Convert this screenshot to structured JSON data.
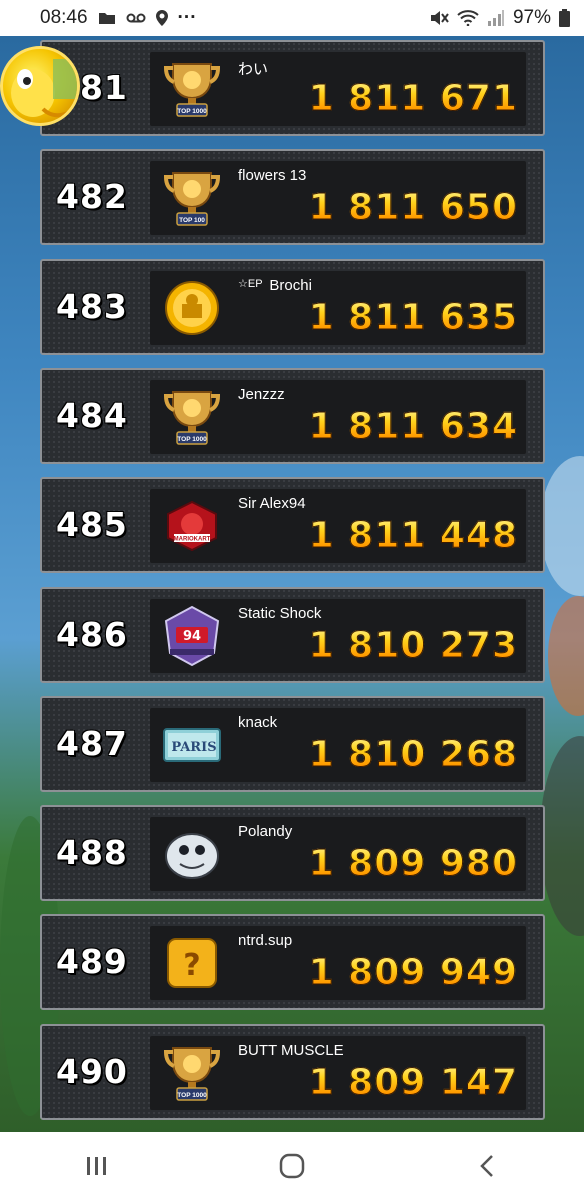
{
  "status_bar": {
    "time": "08:46",
    "battery": "97%",
    "dots": "···"
  },
  "colors": {
    "score_gradient_top": "#fff7a0",
    "score_gradient_bottom": "#ff6a00",
    "row_bg": "#2a2d31",
    "panel_bg": "#1a1b1d"
  },
  "leaderboard": [
    {
      "rank": "481",
      "name": "わい",
      "score": "1 811 671",
      "badge": "trophy-top1000-icon"
    },
    {
      "rank": "482",
      "name": "flowers 13",
      "score": "1 811 650",
      "badge": "trophy-top100-icon"
    },
    {
      "rank": "483",
      "name": "Brochi",
      "score": "1 811 635",
      "badge": "gold-medal-icon"
    },
    {
      "rank": "484",
      "name": "Jenzzz",
      "score": "1 811 634",
      "badge": "trophy-top1000-icon"
    },
    {
      "rank": "485",
      "name": "Sir Alex94",
      "score": "1 811 448",
      "badge": "mariokart-tour-emblem-icon"
    },
    {
      "rank": "486",
      "name": "Static Shock",
      "score": "1 810 273",
      "badge": "number-94-emblem-icon"
    },
    {
      "rank": "487",
      "name": "knack",
      "score": "1 810 268",
      "badge": "paris-sign-icon"
    },
    {
      "rank": "488",
      "name": "Polandy",
      "score": "1 809 980",
      "badge": "dry-bones-icon"
    },
    {
      "rank": "489",
      "name": "ntrd.sup",
      "score": "1 809 949",
      "badge": "question-block-icon"
    },
    {
      "rank": "490",
      "name": "BUTT MUSCLE",
      "score": "1 809 147",
      "badge": "trophy-top1000-icon"
    }
  ],
  "badge_texts": {
    "top1000": "TOP 1000",
    "top100": "TOP 100",
    "emblem_94": "94",
    "paris": "PARIS",
    "question": "?"
  },
  "brochi_prefix": "EP"
}
